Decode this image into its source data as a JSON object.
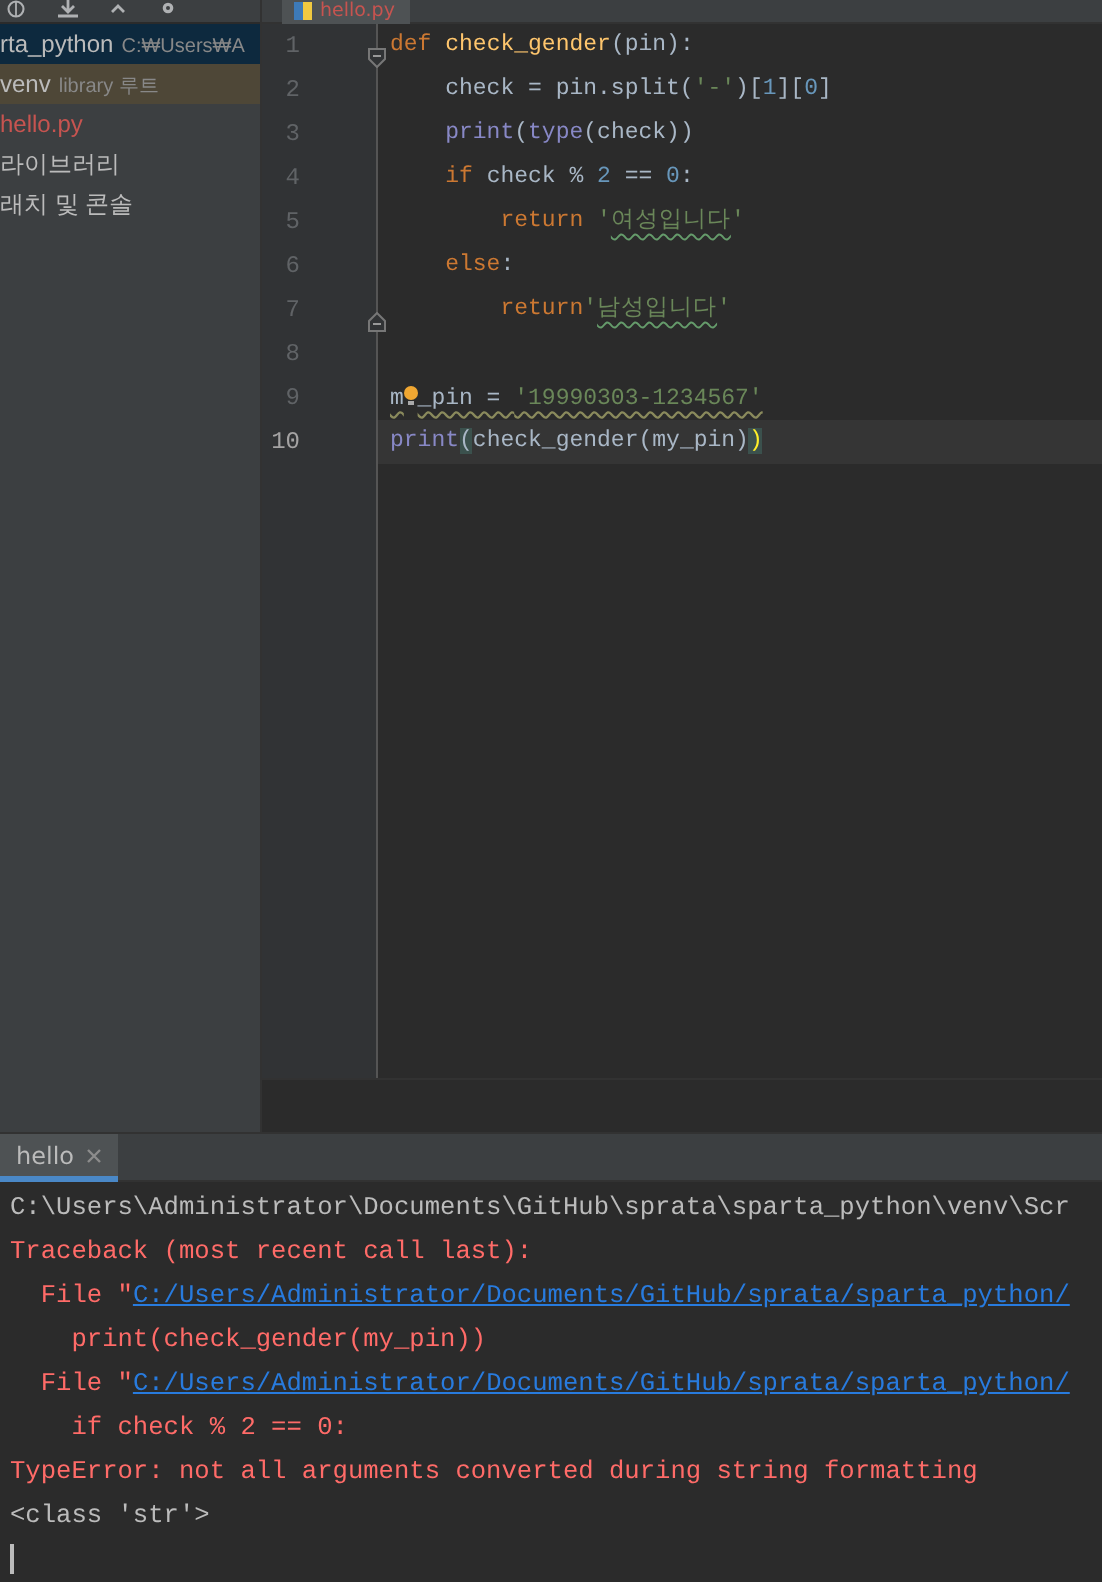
{
  "project_tree": {
    "items": [
      {
        "kind": "project",
        "label": "rta_python",
        "hint": "C:₩Users₩A",
        "selected": true
      },
      {
        "kind": "library",
        "label": "venv",
        "hint": "library 루트",
        "selected": false
      },
      {
        "kind": "error_file",
        "label": "hello.py",
        "selected": false
      },
      {
        "kind": "plain",
        "label": "라이브러리",
        "selected": false
      },
      {
        "kind": "plain",
        "label": "래치 및 콘솔",
        "selected": false
      }
    ]
  },
  "editor": {
    "tab": {
      "label": "hello.py"
    },
    "lines": [
      {
        "number": "1",
        "fold_open": true,
        "current": false,
        "warning": false,
        "tokens": [
          {
            "t": "def ",
            "kind": "keyword"
          },
          {
            "t": "check_gender",
            "kind": "funcdef"
          },
          {
            "t": "(pin):",
            "kind": "plain"
          }
        ]
      },
      {
        "number": "2",
        "current": false,
        "warning": false,
        "tokens": [
          {
            "t": "    check = pin.split(",
            "kind": "plain"
          },
          {
            "t": "'-'",
            "kind": "string"
          },
          {
            "t": ")[",
            "kind": "plain"
          },
          {
            "t": "1",
            "kind": "number"
          },
          {
            "t": "][",
            "kind": "plain"
          },
          {
            "t": "0",
            "kind": "number"
          },
          {
            "t": "]",
            "kind": "plain"
          }
        ]
      },
      {
        "number": "3",
        "current": false,
        "warning": false,
        "tokens": [
          {
            "t": "    print",
            "kind": "builtin"
          },
          {
            "t": "(",
            "kind": "plain"
          },
          {
            "t": "type",
            "kind": "builtin"
          },
          {
            "t": "(check))",
            "kind": "plain"
          }
        ]
      },
      {
        "number": "4",
        "current": false,
        "warning": false,
        "tokens": [
          {
            "t": "    if ",
            "kind": "keyword"
          },
          {
            "t": "check % ",
            "kind": "plain"
          },
          {
            "t": "2",
            "kind": "number"
          },
          {
            "t": " == ",
            "kind": "plain"
          },
          {
            "t": "0",
            "kind": "number"
          },
          {
            "t": ":",
            "kind": "plain"
          }
        ]
      },
      {
        "number": "5",
        "current": false,
        "warning": false,
        "tokens": [
          {
            "t": "        return ",
            "kind": "keyword"
          },
          {
            "t": "'",
            "kind": "string"
          },
          {
            "t": "여성입니다",
            "kind": "string",
            "typo": true
          },
          {
            "t": "'",
            "kind": "string"
          }
        ]
      },
      {
        "number": "6",
        "current": false,
        "warning": false,
        "tokens": [
          {
            "t": "    else",
            "kind": "keyword"
          },
          {
            "t": ":",
            "kind": "plain"
          }
        ]
      },
      {
        "number": "7",
        "fold_close": true,
        "current": false,
        "warning": false,
        "tokens": [
          {
            "t": "        return",
            "kind": "keyword"
          },
          {
            "t": "'",
            "kind": "string"
          },
          {
            "t": "남성입니다",
            "kind": "string",
            "typo": true
          },
          {
            "t": "'",
            "kind": "string"
          }
        ]
      },
      {
        "number": "8",
        "current": false
      },
      {
        "number": "9",
        "current": false,
        "warning": true,
        "tokens": [
          {
            "t": "m",
            "kind": "plain"
          },
          {
            "kind": "bulb"
          },
          {
            "t": "_pin = ",
            "kind": "plain"
          },
          {
            "t": "'19990303-1234567'",
            "kind": "string"
          }
        ]
      },
      {
        "number": "10",
        "current": true,
        "warning": false,
        "tokens": [
          {
            "t": "print",
            "kind": "builtin"
          },
          {
            "t": "(",
            "kind": "plain",
            "matched": true
          },
          {
            "t": "check_gender(my_pin)",
            "kind": "plain"
          },
          {
            "t": ")",
            "kind": "paren",
            "matched": true
          }
        ]
      }
    ]
  },
  "run_panel": {
    "tab": {
      "label": "hello",
      "selected": true
    },
    "lines": [
      {
        "kind": "command",
        "text": "C:\\Users\\Administrator\\Documents\\GitHub\\sprata\\sparta_python\\venv\\Scr"
      },
      {
        "kind": "error",
        "text": "Traceback (most recent call last):"
      },
      {
        "kind": "file",
        "text": "  File \"",
        "link": "C:/Users/Administrator/Documents/GitHub/sprata/sparta_python/"
      },
      {
        "kind": "error",
        "text": "    print(check_gender(my_pin))"
      },
      {
        "kind": "file",
        "text": "  File \"",
        "link": "C:/Users/Administrator/Documents/GitHub/sprata/sparta_python/"
      },
      {
        "kind": "error",
        "text": "    if check % 2 == 0:"
      },
      {
        "kind": "error",
        "text": "TypeError: not all arguments converted during string formatting"
      },
      {
        "kind": "output",
        "text": "<class 'str'>"
      },
      {
        "kind": "cursor"
      }
    ]
  }
}
